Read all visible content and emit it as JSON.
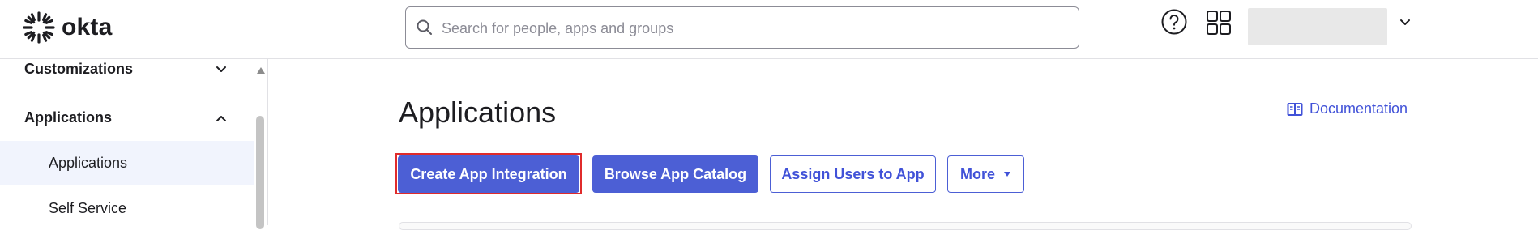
{
  "header": {
    "logo_text": "okta",
    "search_placeholder": "Search for people, apps and groups",
    "search_value": ""
  },
  "sidebar": {
    "sections": [
      {
        "label": "Customizations",
        "expanded": false
      },
      {
        "label": "Applications",
        "expanded": true
      }
    ],
    "items": [
      {
        "label": "Applications",
        "active": true
      },
      {
        "label": "Self Service",
        "active": false
      }
    ]
  },
  "main": {
    "title": "Applications",
    "doc_link": "Documentation",
    "buttons": {
      "create": "Create App Integration",
      "browse": "Browse App Catalog",
      "assign": "Assign Users to App",
      "more": "More"
    }
  },
  "colors": {
    "accent": "#4c5fd5",
    "link": "#4152d8",
    "highlight": "#e02b2b",
    "active_bg": "#f1f4fd"
  },
  "icons": [
    "okta-logo-icon",
    "search-icon",
    "help-icon",
    "apps-grid-icon",
    "chevron-down-icon",
    "chevron-up-icon",
    "book-icon",
    "caret-down-icon",
    "scroll-up-icon"
  ]
}
